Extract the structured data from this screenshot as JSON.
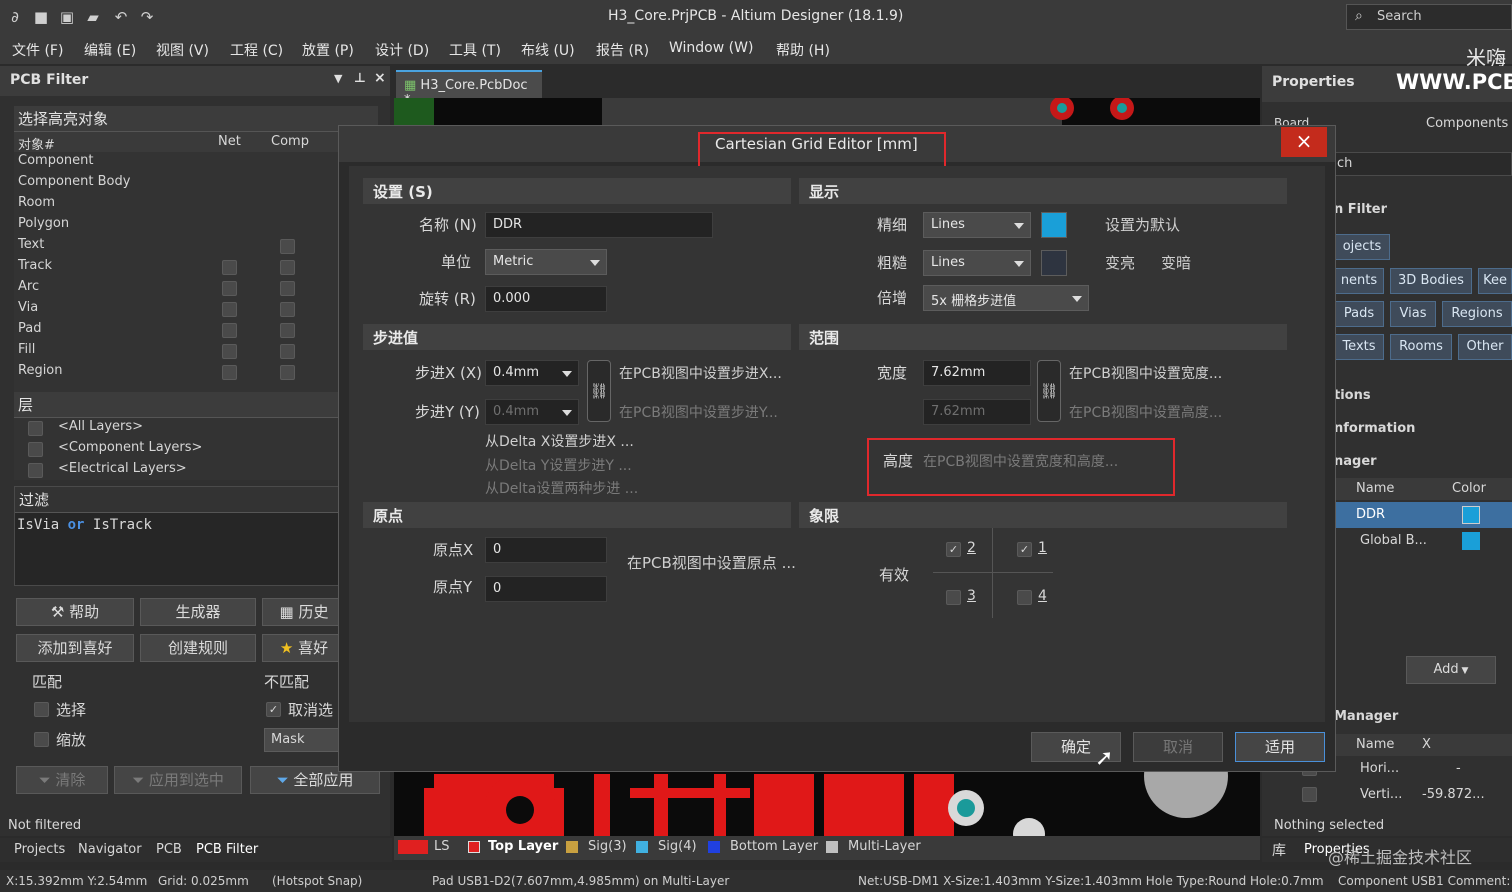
{
  "app": {
    "window_title": "H3_Core.PrjPCB - Altium Designer (18.1.9)",
    "search_label": "Search"
  },
  "menu": [
    "文件 (F)",
    "编辑 (E)",
    "视图 (V)",
    "工程 (C)",
    "放置 (P)",
    "设计 (D)",
    "工具 (T)",
    "布线 (U)",
    "报告 (R)",
    "Window (W)",
    "帮助 (H)"
  ],
  "watermark_top": "米嗨",
  "left_panel": {
    "title": "PCB Filter",
    "highlight_section": "选择高亮对象",
    "col_object": "对象#",
    "col_net": "Net",
    "col_comp": "Comp",
    "objects": [
      "Component",
      "Component Body",
      "Room",
      "Polygon",
      "Text",
      "Track",
      "Arc",
      "Via",
      "Pad",
      "Fill",
      "Region"
    ],
    "layers_section": "层",
    "layers": [
      "<All Layers>",
      "<Component Layers>",
      "<Electrical Layers>"
    ],
    "filter_section": "过滤",
    "filter_expr_a": "IsVia",
    "filter_expr_op": "or",
    "filter_expr_b": "IsTrack",
    "btn_help": "帮助",
    "btn_builder": "生成器",
    "btn_history": "历史",
    "btn_add_fav": "添加到喜好",
    "btn_create_rule": "创建规则",
    "btn_fav": "喜好",
    "match_label": "匹配",
    "nomatch_label": "不匹配",
    "opt_select": "选择",
    "opt_zoom": "缩放",
    "opt_deselect": "取消选",
    "mask_value": "Mask",
    "btn_clear": "清除",
    "btn_apply_sel": "应用到选中",
    "btn_apply_all": "全部应用",
    "status": "Not filtered",
    "tabs": [
      "Projects",
      "Navigator",
      "PCB",
      "PCB Filter"
    ]
  },
  "doc_tab": "H3_Core.PcbDoc *",
  "right_panel": {
    "title": "Properties",
    "brand": "WWW.PCB",
    "board_label": "Board",
    "components_label": "Components",
    "search_stub": "ch",
    "filter_label": "n Filter",
    "objects_btn": "ojects",
    "btns_row1": [
      "nents",
      "3D Bodies",
      "Kee"
    ],
    "btns_row2": [
      "Pads",
      "Vias",
      "Regions"
    ],
    "btns_row3": [
      "Texts",
      "Rooms",
      "Other"
    ],
    "sec_options": "tions",
    "sec_information": "nformation",
    "sec_manager": "nager",
    "col_name": "Name",
    "col_color": "Color",
    "grid_rows": [
      {
        "name": "DDR",
        "color": "#1a9fd8"
      },
      {
        "name": "Global B...",
        "color": "#1a9fd8"
      }
    ],
    "add_btn": "Add",
    "manager2": "Manager",
    "col_name2": "Name",
    "col_x": "X",
    "guide_rows": [
      {
        "name": "Hori...",
        "x": "-"
      },
      {
        "name": "Verti...",
        "x": "-59.872..."
      }
    ],
    "nothing_selected": "Nothing selected",
    "bottom_tabs": [
      "库",
      "Properties"
    ],
    "watermark": "@稀土掘金技术社区"
  },
  "dialog": {
    "title": "Cartesian Grid Editor [mm]",
    "close": "×",
    "settings": {
      "header": "设置 (S)",
      "name_label": "名称 (N)",
      "name_value": "DDR",
      "unit_label": "单位",
      "unit_value": "Metric",
      "rotation_label": "旋转 (R)",
      "rotation_value": "0.000"
    },
    "display": {
      "header": "显示",
      "fine_label": "精细",
      "fine_value": "Lines",
      "fine_color": "#1a9fd8",
      "coarse_label": "粗糙",
      "coarse_value": "Lines",
      "coarse_color": "#2e3440",
      "set_default": "设置为默认",
      "lighter": "变亮",
      "darker": "变暗",
      "multiplier_label": "倍增",
      "multiplier_value": "5x 栅格步进值"
    },
    "step": {
      "header": "步进值",
      "stepx_label": "步进X (X)",
      "stepx_value": "0.4mm",
      "stepx_link": "在PCB视图中设置步进X...",
      "stepy_label": "步进Y (Y)",
      "stepy_value": "0.4mm",
      "stepy_link": "在PCB视图中设置步进Y...",
      "from_dx": "从Delta X设置步进X ...",
      "from_dy": "从Delta Y设置步进Y ...",
      "from_d": "从Delta设置两种步进 ..."
    },
    "range": {
      "header": "范围",
      "width_label": "宽度",
      "width_value": "7.62mm",
      "width_link": "在PCB视图中设置宽度...",
      "height_value": "7.62mm",
      "height_link": "在PCB视图中设置高度...",
      "height_label": "高度",
      "both_link": "在PCB视图中设置宽度和高度..."
    },
    "origin": {
      "header": "原点",
      "ox_label": "原点X",
      "ox_value": "0",
      "oy_label": "原点Y",
      "oy_value": "0",
      "set_origin": "在PCB视图中设置原点 ..."
    },
    "quadrant": {
      "header": "象限",
      "enabled_label": "有效",
      "q1": "1",
      "q2": "2",
      "q3": "3",
      "q4": "4"
    },
    "ok": "确定",
    "cancel": "取消",
    "apply": "适用"
  },
  "layer_bar": {
    "ls": "LS",
    "layers": [
      {
        "name": "Top Layer",
        "color": "#e02020"
      },
      {
        "name": "Sig(3)",
        "color": "#c8a040"
      },
      {
        "name": "Sig(4)",
        "color": "#40b0e0"
      },
      {
        "name": "Bottom Layer",
        "color": "#2040e0"
      },
      {
        "name": "Multi-Layer",
        "color": "#c0c0c0"
      }
    ]
  },
  "status": {
    "coords": "X:15.392mm Y:2.54mm",
    "grid": "Grid: 0.025mm",
    "snap": "(Hotspot Snap)",
    "pad": "Pad USB1-D2(7.607mm,4.985mm) on Multi-Layer",
    "net": "Net:USB-DM1 X-Size:1.403mm Y-Size:1.403mm Hole Type:Round Hole:0.7mm",
    "component": "Component USB1 Comment:"
  }
}
